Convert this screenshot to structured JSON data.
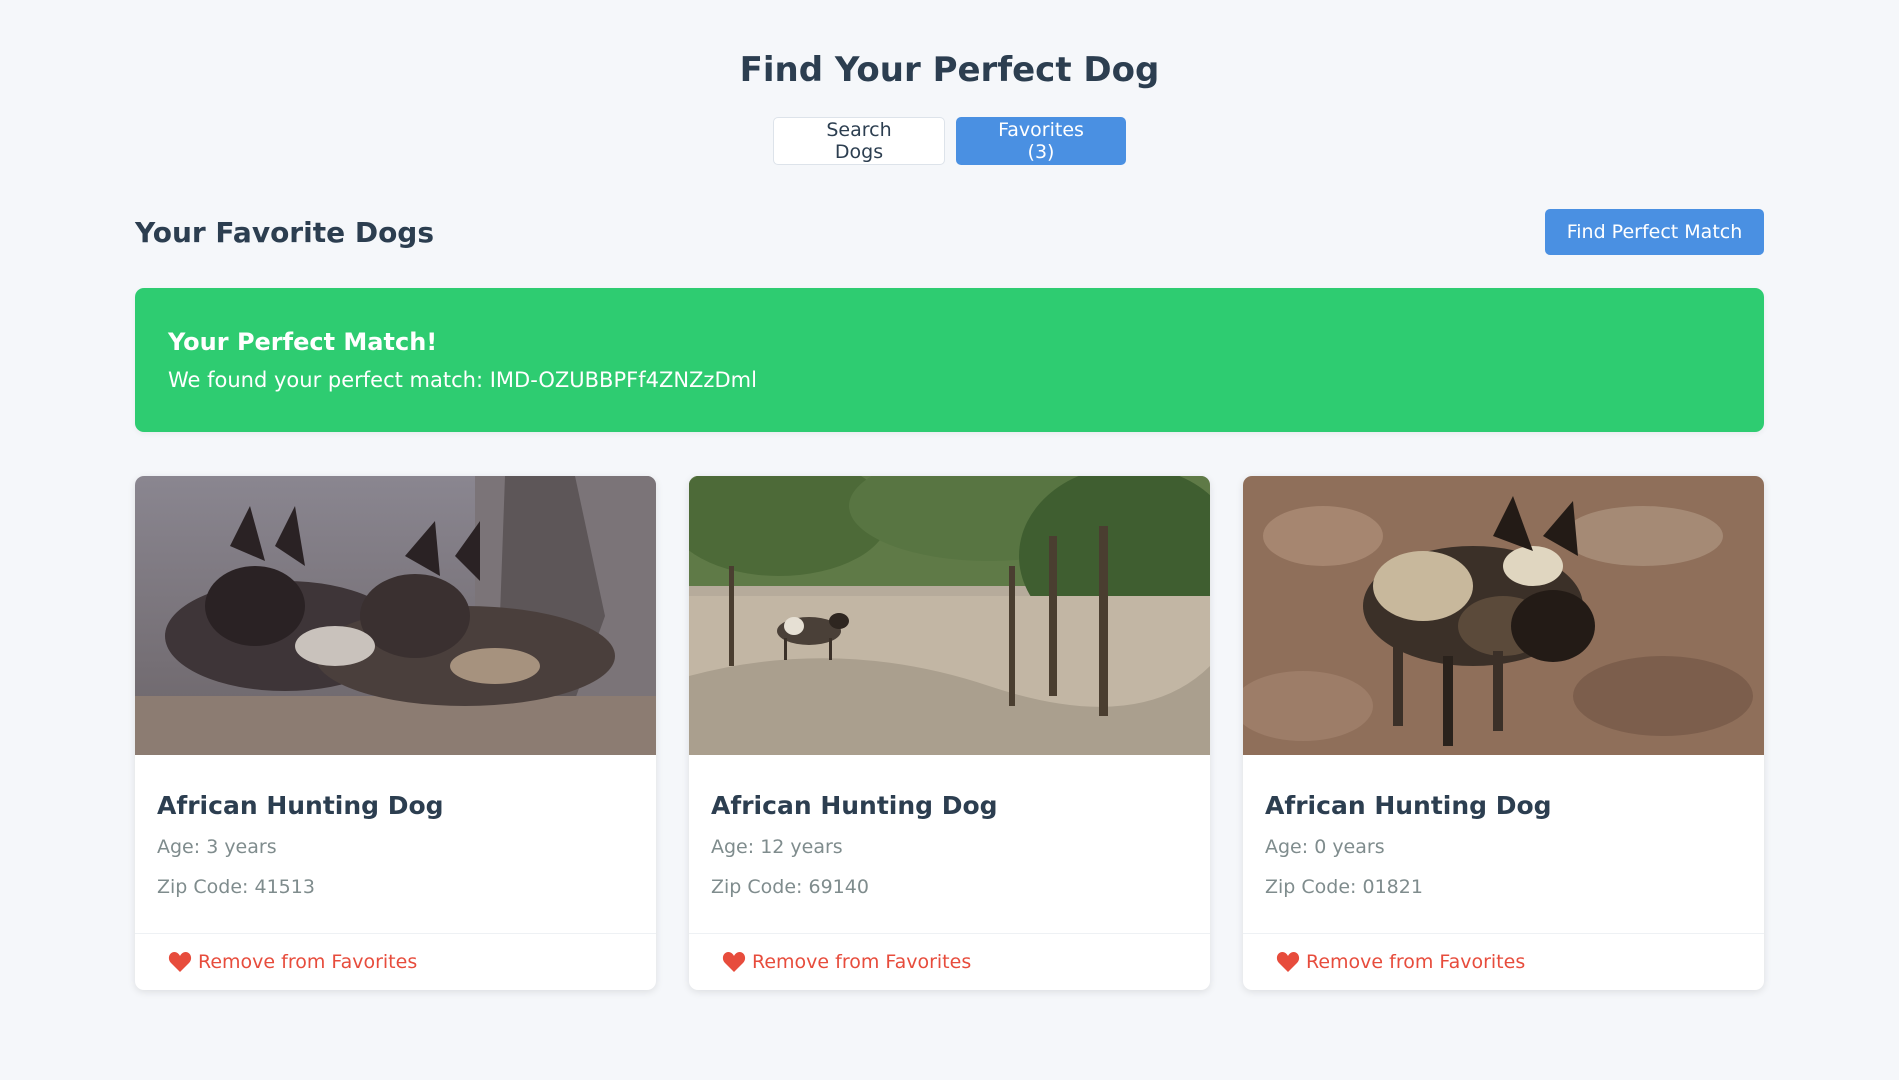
{
  "header": {
    "title": "Find Your Perfect Dog"
  },
  "tabs": [
    {
      "label": "Search Dogs",
      "active": false
    },
    {
      "label": "Favorites (3)",
      "active": true
    }
  ],
  "favorites": {
    "title": "Your Favorite Dogs",
    "match_button_label": "Find Perfect Match"
  },
  "match": {
    "heading": "Your Perfect Match!",
    "message": "We found your perfect match: IMD-OZUBBPFf4ZNZzDml",
    "color": "#2ecc71"
  },
  "cards": [
    {
      "name": "African Hunting Dog",
      "age": "Age: 3 years",
      "zip": "Zip Code: 41513",
      "action_label": "Remove from Favorites",
      "icon": "heart-icon"
    },
    {
      "name": "African Hunting Dog",
      "age": "Age: 12 years",
      "zip": "Zip Code: 69140",
      "action_label": "Remove from Favorites",
      "icon": "heart-icon"
    },
    {
      "name": "African Hunting Dog",
      "age": "Age: 0 years",
      "zip": "Zip Code: 01821",
      "action_label": "Remove from Favorites",
      "icon": "heart-icon"
    }
  ],
  "colors": {
    "accent": "#4a90e2",
    "danger": "#e74c3c",
    "background": "#f5f7fa"
  }
}
